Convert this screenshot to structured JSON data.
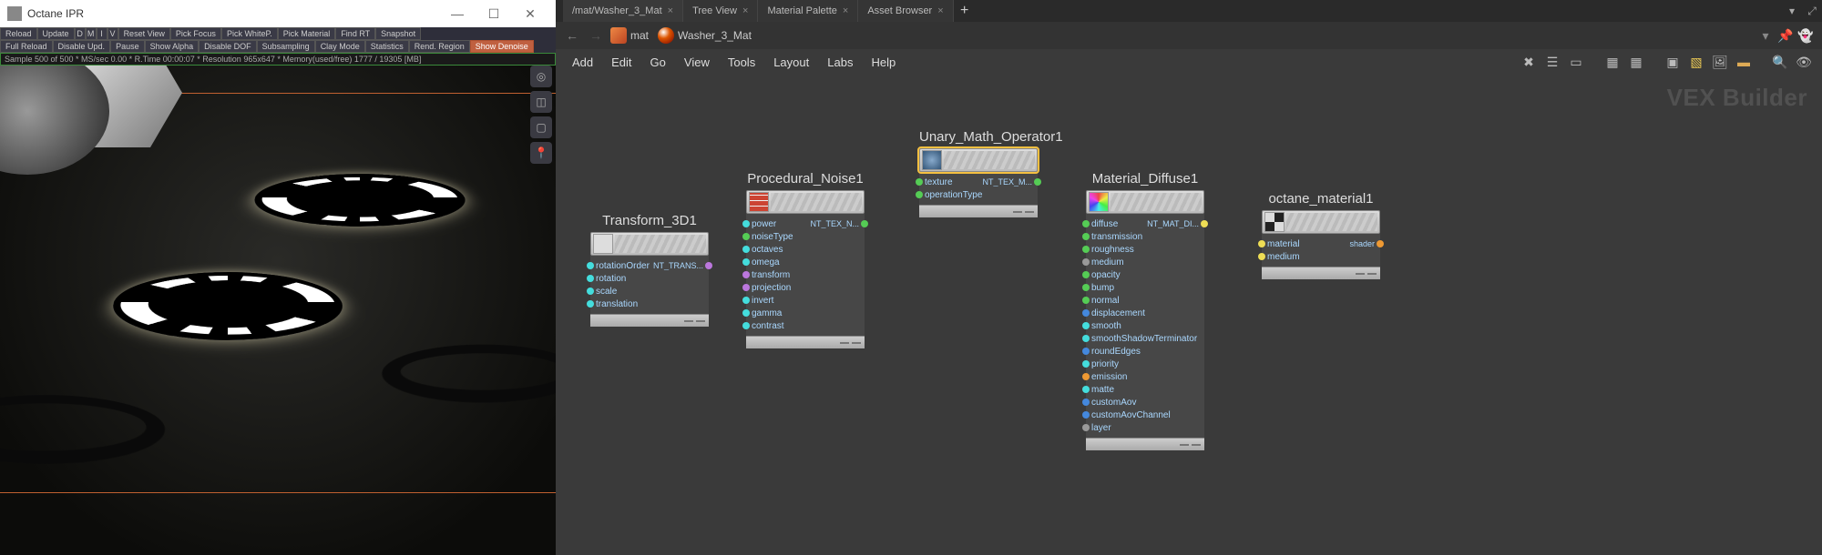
{
  "left": {
    "title": "Octane IPR",
    "toolbar1": [
      "Reload",
      "Update",
      "D",
      "M",
      "I",
      "V",
      "Reset View",
      "Pick Focus",
      "Pick WhiteP.",
      "Pick Material",
      "Find RT",
      "Snapshot"
    ],
    "toolbar2": [
      "Full Reload",
      "Disable Upd.",
      "Pause",
      "Show Alpha",
      "Disable DOF",
      "Subsampling",
      "Clay Mode",
      "Statistics",
      "Rend. Region",
      "Show Denoise"
    ],
    "status": "Sample 500 of 500 * MS/sec 0.00 * R.Time 00:00:07 * Resolution 965x647 * Memory(used/free) 1777 / 19305 [MB]",
    "side_icons": [
      "target-icon",
      "cube-icon",
      "square-icon",
      "pin-icon"
    ]
  },
  "right": {
    "tabs": [
      "/mat/Washer_3_Mat",
      "Tree View",
      "Material Palette",
      "Asset Browser"
    ],
    "path": [
      {
        "icon": "mat",
        "label": "mat"
      },
      {
        "icon": "ball",
        "label": "Washer_3_Mat"
      }
    ],
    "menu": [
      "Add",
      "Edit",
      "Go",
      "View",
      "Tools",
      "Layout",
      "Labs",
      "Help"
    ],
    "watermark": "VEX Builder",
    "nodes": {
      "transform": {
        "title": "Transform_3D1",
        "rows": [
          {
            "label": "rotationOrder",
            "val": "NT_TRANS...",
            "in": "c-cyan",
            "out": "c-purple"
          },
          {
            "label": "rotation",
            "in": "c-cyan"
          },
          {
            "label": "scale",
            "in": "c-cyan"
          },
          {
            "label": "translation",
            "in": "c-cyan"
          }
        ]
      },
      "noise": {
        "title": "Procedural_Noise1",
        "rows": [
          {
            "label": "power",
            "val": "NT_TEX_N...",
            "in": "c-cyan",
            "out": "c-green"
          },
          {
            "label": "noiseType",
            "in": "c-green"
          },
          {
            "label": "octaves",
            "in": "c-cyan"
          },
          {
            "label": "omega",
            "in": "c-cyan"
          },
          {
            "label": "transform",
            "in": "c-purple"
          },
          {
            "label": "projection",
            "in": "c-purple"
          },
          {
            "label": "invert",
            "in": "c-cyan"
          },
          {
            "label": "gamma",
            "in": "c-cyan"
          },
          {
            "label": "contrast",
            "in": "c-cyan"
          }
        ]
      },
      "unary": {
        "title": "Unary_Math_Operator1",
        "rows": [
          {
            "label": "texture",
            "val": "NT_TEX_M...",
            "in": "c-green",
            "out": "c-green"
          },
          {
            "label": "operationType",
            "in": "c-green"
          }
        ]
      },
      "diffuse": {
        "title": "Material_Diffuse1",
        "rows": [
          {
            "label": "diffuse",
            "val": "NT_MAT_DI...",
            "in": "c-green",
            "out": "c-yellow"
          },
          {
            "label": "transmission",
            "in": "c-green"
          },
          {
            "label": "roughness",
            "in": "c-green"
          },
          {
            "label": "medium",
            "in": "c-gray"
          },
          {
            "label": "opacity",
            "in": "c-green"
          },
          {
            "label": "bump",
            "in": "c-green"
          },
          {
            "label": "normal",
            "in": "c-green"
          },
          {
            "label": "displacement",
            "in": "c-blue"
          },
          {
            "label": "smooth",
            "in": "c-cyan"
          },
          {
            "label": "smoothShadowTerminator",
            "in": "c-cyan"
          },
          {
            "label": "roundEdges",
            "in": "c-blue"
          },
          {
            "label": "priority",
            "in": "c-cyan"
          },
          {
            "label": "emission",
            "in": "c-orange"
          },
          {
            "label": "matte",
            "in": "c-cyan"
          },
          {
            "label": "customAov",
            "in": "c-blue"
          },
          {
            "label": "customAovChannel",
            "in": "c-blue"
          },
          {
            "label": "layer",
            "in": "c-gray"
          }
        ]
      },
      "octmat": {
        "title": "octane_material1",
        "rows": [
          {
            "label": "material",
            "val": "shader",
            "in": "c-yellow",
            "out": "c-orange"
          },
          {
            "label": "medium",
            "in": "c-yellow"
          }
        ]
      }
    }
  }
}
